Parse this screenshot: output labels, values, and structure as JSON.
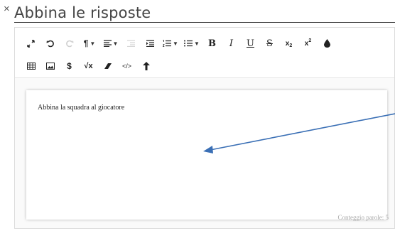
{
  "dialog": {
    "title": "Abbina le risposte",
    "close_glyph": "×"
  },
  "toolbar": {
    "row1": [
      {
        "name": "fullscreen-icon",
        "glyph": "⤢",
        "disabled": false
      },
      {
        "name": "undo-icon",
        "glyph": "↶",
        "disabled": false
      },
      {
        "name": "redo-icon",
        "glyph": "↷",
        "disabled": true
      },
      {
        "name": "paragraph-format-icon",
        "glyph": "¶",
        "dropdown": true,
        "disabled": false
      },
      {
        "name": "align-icon",
        "glyph": "≡",
        "dropdown": true,
        "disabled": false
      },
      {
        "name": "outdent-icon",
        "glyph": "⇤",
        "disabled": true
      },
      {
        "name": "indent-icon",
        "glyph": "⇥",
        "disabled": false
      },
      {
        "name": "ordered-list-icon",
        "glyph": "⒈",
        "dropdown": true,
        "disabled": false
      },
      {
        "name": "unordered-list-icon",
        "glyph": "☰",
        "dropdown": true,
        "disabled": false
      },
      {
        "name": "bold-icon",
        "glyph": "B",
        "disabled": false
      },
      {
        "name": "italic-icon",
        "glyph": "I",
        "disabled": false
      },
      {
        "name": "underline-icon",
        "glyph": "U",
        "disabled": false
      },
      {
        "name": "strikethrough-icon",
        "glyph": "S",
        "disabled": false
      },
      {
        "name": "subscript-icon",
        "glyph": "x₂",
        "disabled": false
      },
      {
        "name": "superscript-icon",
        "glyph": "x²",
        "disabled": false
      },
      {
        "name": "text-color-icon",
        "glyph": "💧",
        "disabled": false
      }
    ],
    "row2": [
      {
        "name": "table-icon",
        "glyph": "▦"
      },
      {
        "name": "image-icon",
        "glyph": "▣"
      },
      {
        "name": "dollar-icon",
        "glyph": "$"
      },
      {
        "name": "math-sqrt-icon",
        "glyph": "√x"
      },
      {
        "name": "eraser-icon",
        "glyph": "⌫"
      },
      {
        "name": "code-view-icon",
        "glyph": "</>"
      },
      {
        "name": "arrow-up-icon",
        "glyph": "↑"
      }
    ]
  },
  "content": {
    "text": "Abbina la squadra al giocatore",
    "word_count": "Conteggio parole: 5"
  },
  "annotation": {
    "arrow_color": "#3a6fb5"
  }
}
